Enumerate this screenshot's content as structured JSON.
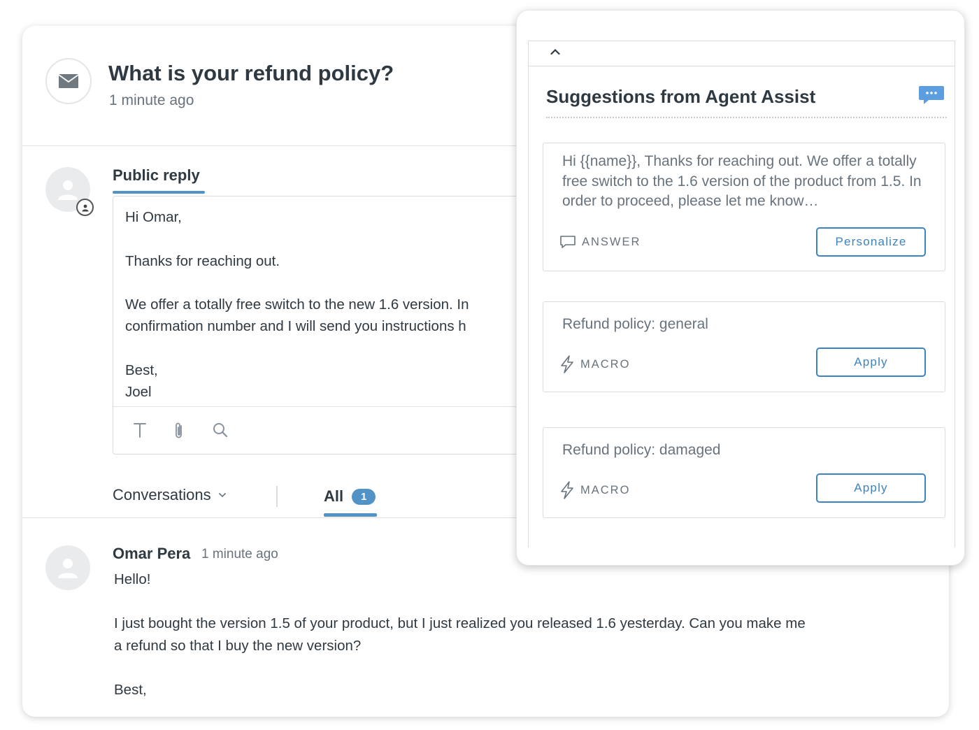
{
  "ticket": {
    "title": "What is your refund policy?",
    "time": "1 minute ago"
  },
  "reply": {
    "tab_label": "Public reply",
    "body_lines": [
      "Hi Omar,",
      "",
      "Thanks for reaching out.",
      "",
      "We offer a totally free switch to the new 1.6 version. In",
      "confirmation number and I will send you instructions h",
      "",
      "Best,",
      "Joel"
    ]
  },
  "conversations": {
    "dropdown_label": "Conversations",
    "all_label": "All",
    "all_count": "1"
  },
  "message": {
    "author": "Omar Pera",
    "time": "1 minute ago",
    "lines": [
      "Hello!",
      "",
      "I just bought the version 1.5 of your product, but I just realized you released 1.6 yesterday. Can you make me",
      "a refund so that I buy the new version?",
      "",
      "Best,"
    ]
  },
  "assist": {
    "title": "Suggestions from Agent Assist",
    "suggestions": [
      {
        "text": "Hi {{name}}, Thanks for reaching out. We offer a totally free switch to the 1.6 version of the product from 1.5. In order to proceed, please let me know…",
        "type": "ANSWER",
        "icon": "speech-bubble-icon",
        "button": "Personalize"
      },
      {
        "text": "Refund policy: general",
        "type": "MACRO",
        "icon": "lightning-icon",
        "button": "Apply"
      },
      {
        "text": "Refund policy: damaged",
        "type": "MACRO",
        "icon": "lightning-icon",
        "button": "Apply"
      }
    ]
  },
  "icons": {
    "channel": "envelope-icon",
    "agent_avatar": "person-icon",
    "toolbar": [
      "text-format-icon",
      "paperclip-icon",
      "search-icon"
    ],
    "collapse": "chevron-up-icon",
    "assist": "chat-bubble-icon"
  },
  "colors": {
    "accent": "#5293c7",
    "button": "#3b84c4",
    "text": "#2f3941",
    "muted": "#68737d"
  }
}
